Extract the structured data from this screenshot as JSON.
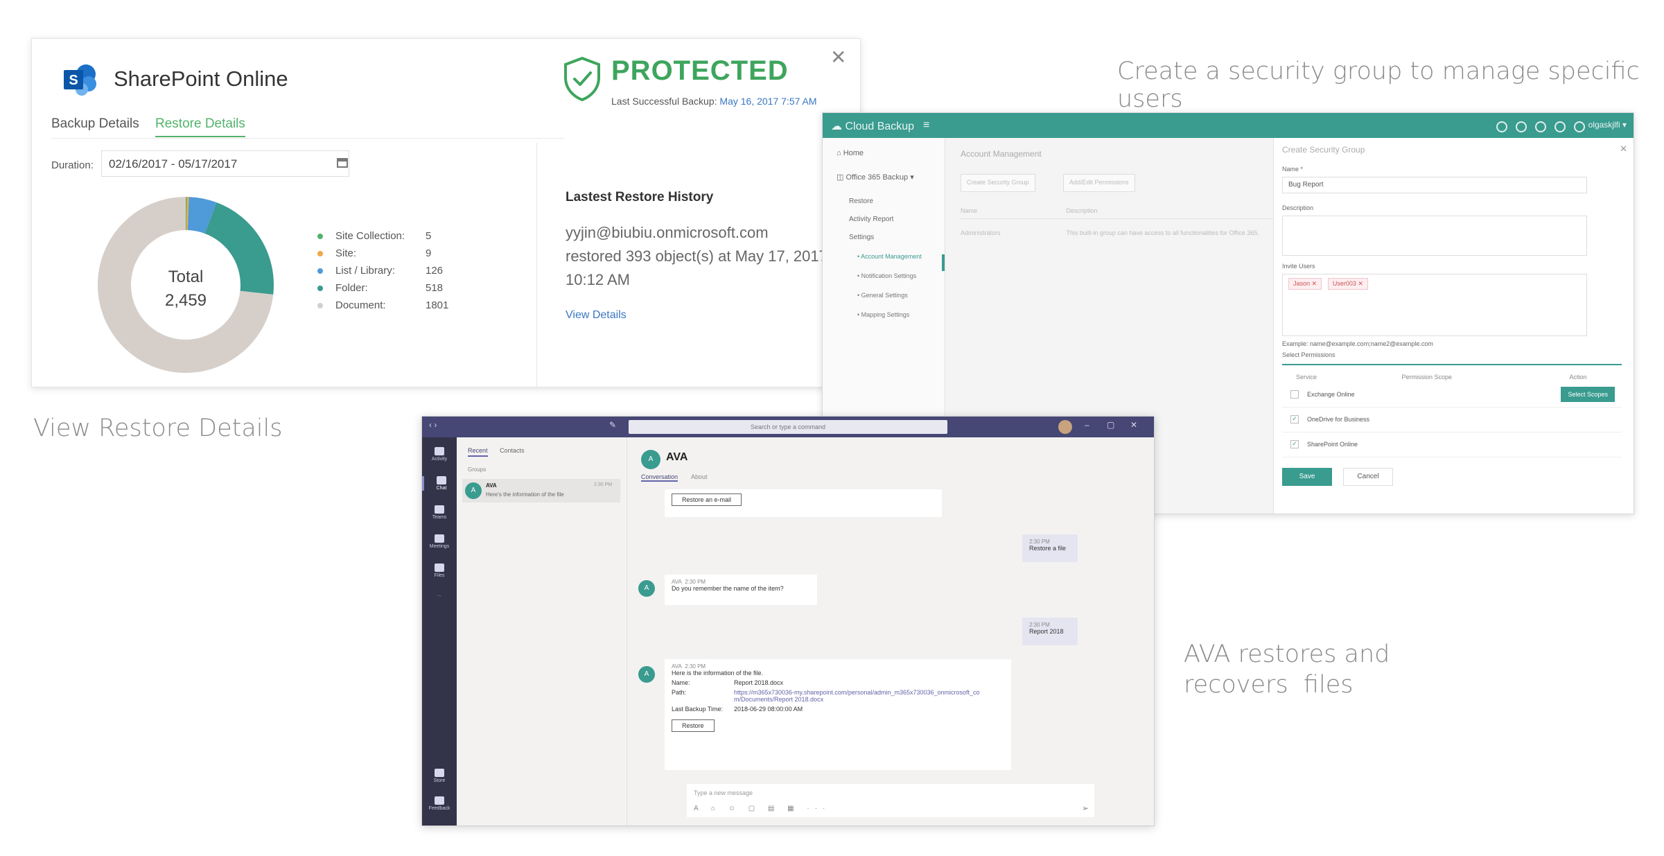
{
  "captions": {
    "security": "Create a security group to manage specific users",
    "restore": "View Restore Details",
    "ava_line1": "AVA restores and",
    "ava_line2": "recovers  files"
  },
  "sharepoint": {
    "title": "SharePoint Online",
    "tabs": [
      "Backup Details",
      "Restore Details"
    ],
    "active_tab": "Restore Details",
    "status": "PROTECTED",
    "last_backup_label": "Last Successful Backup:",
    "last_backup_value": "May 16, 2017 7:57 AM",
    "close_glyph": "✕",
    "duration_label": "Duration:",
    "duration_value": "02/16/2017 - 05/17/2017",
    "donut_total_label": "Total",
    "donut_total_value": "2,459",
    "legend": [
      {
        "label": "Site Collection:",
        "value": "5",
        "color": "#52b36b"
      },
      {
        "label": "Site:",
        "value": "9",
        "color": "#f0a848"
      },
      {
        "label": "List / Library:",
        "value": "126",
        "color": "#4f9ad8"
      },
      {
        "label": "Folder:",
        "value": "518",
        "color": "#3a9b8f"
      },
      {
        "label": "Document:",
        "value": "1801",
        "color": "#d6cfc9"
      }
    ],
    "restore_history_title": "Lastest Restore History",
    "restore_history_email": "yyjin@biubiu.onmicrosoft.com",
    "restore_history_text": "restored 393 object(s) at May 17, 2017",
    "restore_history_time": "10:12 AM",
    "view_details": "View Details",
    "colors": {
      "accent": "#52b36b",
      "link": "#3a77c2",
      "protected": "#3ea55d"
    }
  },
  "cloud_backup": {
    "brand": "Cloud Backup",
    "menu_glyph": "≡",
    "user": "olgaskjlfi ▾",
    "nav": {
      "home": "Home",
      "o365": "Office 365 Backup",
      "restore": "Restore",
      "activity": "Activity Report",
      "settings": "Settings",
      "account_mgmt": "Account Management",
      "notification": "Notification Settings",
      "general": "General Settings",
      "mapping": "Mapping Settings"
    },
    "main_title": "Account Management",
    "main_buttons": [
      "Create Security Group",
      "Add/Edit Permissions"
    ],
    "main_cols": [
      "Name",
      "Description"
    ],
    "main_row": [
      "Administrators",
      "This built-in group can have access to all functionalities for Office 365."
    ],
    "dialog": {
      "title": "Create Security Group",
      "close_glyph": "✕",
      "name_label": "Name *",
      "name_value": "Bug Report",
      "desc_label": "Description",
      "invite_label": "Invite Users",
      "chips": [
        "Jason",
        "User003"
      ],
      "example": "Example: name@example.com;name2@example.com",
      "perm_label": "Select Permissions",
      "perm_cols": [
        "Service",
        "Permission Scope",
        "Action"
      ],
      "perm_rows": [
        {
          "name": "Exchange Online",
          "checked": false
        },
        {
          "name": "OneDrive for Business",
          "checked": true
        },
        {
          "name": "SharePoint Online",
          "checked": true
        }
      ],
      "select_groups": "Select Scopes",
      "save": "Save",
      "cancel": "Cancel"
    },
    "colors": {
      "accent": "#3a9b8f"
    }
  },
  "teams": {
    "search_placeholder": "Search or type a command",
    "rail": [
      "Activity",
      "Chat",
      "Teams",
      "Meetings",
      "Files",
      "...",
      "Store",
      "Feedback"
    ],
    "list_tabs": [
      "Recent",
      "Contacts"
    ],
    "list_group": "Groups",
    "chat_name": "AVA",
    "chat_preview": "Here's the information of the file",
    "chat_time": "2:30 PM",
    "avatar_text": "A",
    "conv_title": "AVA",
    "conv_tabs": [
      "Conversation",
      "About"
    ],
    "messages": {
      "restore_email_btn": "Restore an e-mail",
      "me1_time": "2:30 PM",
      "me1_text": "Restore a file",
      "ava1_name": "AVA",
      "ava1_time": "2:30 PM",
      "ava1_text": "Do you remember the name of the item?",
      "me2_time": "2:30 PM",
      "me2_text": "Report 2018",
      "ava2_name": "AVA",
      "ava2_time": "2:30 PM",
      "ava2_intro": "Here is the information of the file.",
      "name_key": "Name:",
      "name_val": "Report 2018.docx",
      "path_key": "Path:",
      "path_val": "https://m365x730036-my.sharepoint.com/personal/admin_m365x730036_onmicrosoft_com/Documents/Report 2018.docx",
      "backup_key": "Last Backup Time:",
      "backup_val": "2018-06-29 08:00:00 AM",
      "restore_btn": "Restore"
    },
    "compose_placeholder": "Type a new message",
    "compose_icons": "A ⌂ ☺ ▢ ▤ ▦ ···",
    "send_glyph": "➢",
    "colors": {
      "titlebar": "#464775",
      "rail": "#33344a",
      "accent": "#6264a7"
    }
  }
}
